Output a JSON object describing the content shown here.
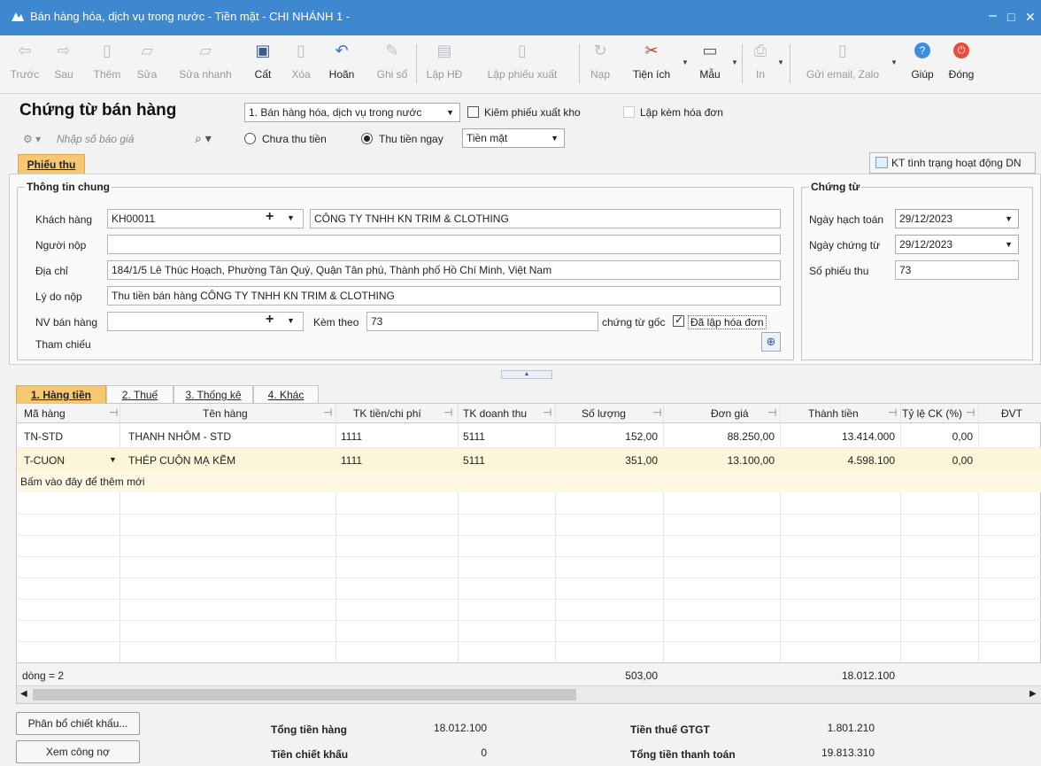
{
  "window": {
    "title": "Bán hàng hóa, dịch vụ trong nước - Tiền mặt - CHI NHÁNH 1 -",
    "minimize": "–",
    "maximize": "□",
    "close": "✕"
  },
  "toolbar": {
    "back": "Trước",
    "next": "Sau",
    "add": "Thêm",
    "edit": "Sửa",
    "quick_edit": "Sửa nhanh",
    "save": "Cất",
    "delete": "Xóa",
    "undo": "Hoãn",
    "post": "Ghi sổ",
    "create_invoice": "Lập HĐ",
    "create_export": "Lập phiếu xuất",
    "load": "Nạp",
    "utilities": "Tiện ích",
    "template": "Mẫu",
    "print": "In",
    "send": "Gửi email, Zalo",
    "help": "Giúp",
    "close": "Đóng"
  },
  "header": {
    "title": "Chứng từ bán hàng",
    "voucher_type": "1. Bán hàng hóa, dịch vụ trong nước",
    "cb_export": "Kiêm phiếu xuất kho",
    "cb_invoice": "Lập kèm hóa đơn",
    "quote_placeholder": "Nhập số báo giá",
    "radio_unpaid": "Chưa thu tiền",
    "radio_paid": "Thu tiền ngay",
    "payment_method": "Tiền mặt"
  },
  "tabs": {
    "receipt": "Phiếu thu",
    "kt_status": "KT tình trạng hoạt động DN"
  },
  "general": {
    "title": "Thông tin chung",
    "customer_label": "Khách hàng",
    "customer_code": "KH00011",
    "customer_name": "CÔNG TY TNHH KN TRIM & CLOTHING",
    "payer_label": "Người nộp",
    "payer": "",
    "address_label": "Địa chỉ",
    "address": "184/1/5 Lê Thúc Hoạch, Phường Tân Quý, Quận Tân phú, Thành phố Hồ Chí Minh, Việt Nam",
    "reason_label": "Lý do nộp",
    "reason": "Thu tiền bán hàng CÔNG TY TNHH KN TRIM & CLOTHING",
    "staff_label": "NV bán hàng",
    "staff": "",
    "attach_label": "Kèm theo",
    "attach": "73",
    "orig_label": "chứng từ gốc",
    "invoiced_label": "Đã lập hóa đơn",
    "ref_label": "Tham chiếu"
  },
  "voucher": {
    "title": "Chứng từ",
    "acc_date_label": "Ngày hạch toán",
    "acc_date": "29/12/2023",
    "doc_date_label": "Ngày chứng từ",
    "doc_date": "29/12/2023",
    "no_label": "Số phiếu thu",
    "no": "73"
  },
  "detail_tabs": [
    "1. Hàng tiền",
    "2. Thuế",
    "3. Thống kê",
    "4. Khác"
  ],
  "grid": {
    "headers": [
      "Mã hàng",
      "Tên hàng",
      "TK tiền/chi phí",
      "TK doanh thu",
      "Số lượng",
      "Đơn giá",
      "Thành tiền",
      "Tỷ lệ CK (%)",
      "ĐVT"
    ],
    "rows": [
      [
        "TN-STD",
        "THANH NHÔM - STD",
        "1111",
        "5111",
        "152,00",
        "88.250,00",
        "13.414.000",
        "0,00",
        ""
      ],
      [
        "T-CUON",
        "THÉP CUỘN MẠ KẼM",
        "1111",
        "5111",
        "351,00",
        "13.100,00",
        "4.598.100",
        "0,00",
        ""
      ]
    ],
    "add_new": "Bấm vào đây để thêm mới",
    "footer_count": "dòng = 2",
    "footer_qty": "503,00",
    "footer_amount": "18.012.100"
  },
  "bottom": {
    "btn_discount": "Phân bổ chiết khấu...",
    "btn_debt": "Xem công nợ",
    "total_goods_label": "Tổng tiền hàng",
    "total_goods": "18.012.100",
    "discount_label": "Tiền chiết khấu",
    "discount": "0",
    "vat_label": "Tiền thuế GTGT",
    "vat": "1.801.210",
    "payment_label": "Tổng tiền thanh toán",
    "payment": "19.813.310"
  },
  "colors": {
    "titlebar": "#3e88cf",
    "selected_row": "#fdf5d8",
    "accent_tab": "#f6c873"
  }
}
